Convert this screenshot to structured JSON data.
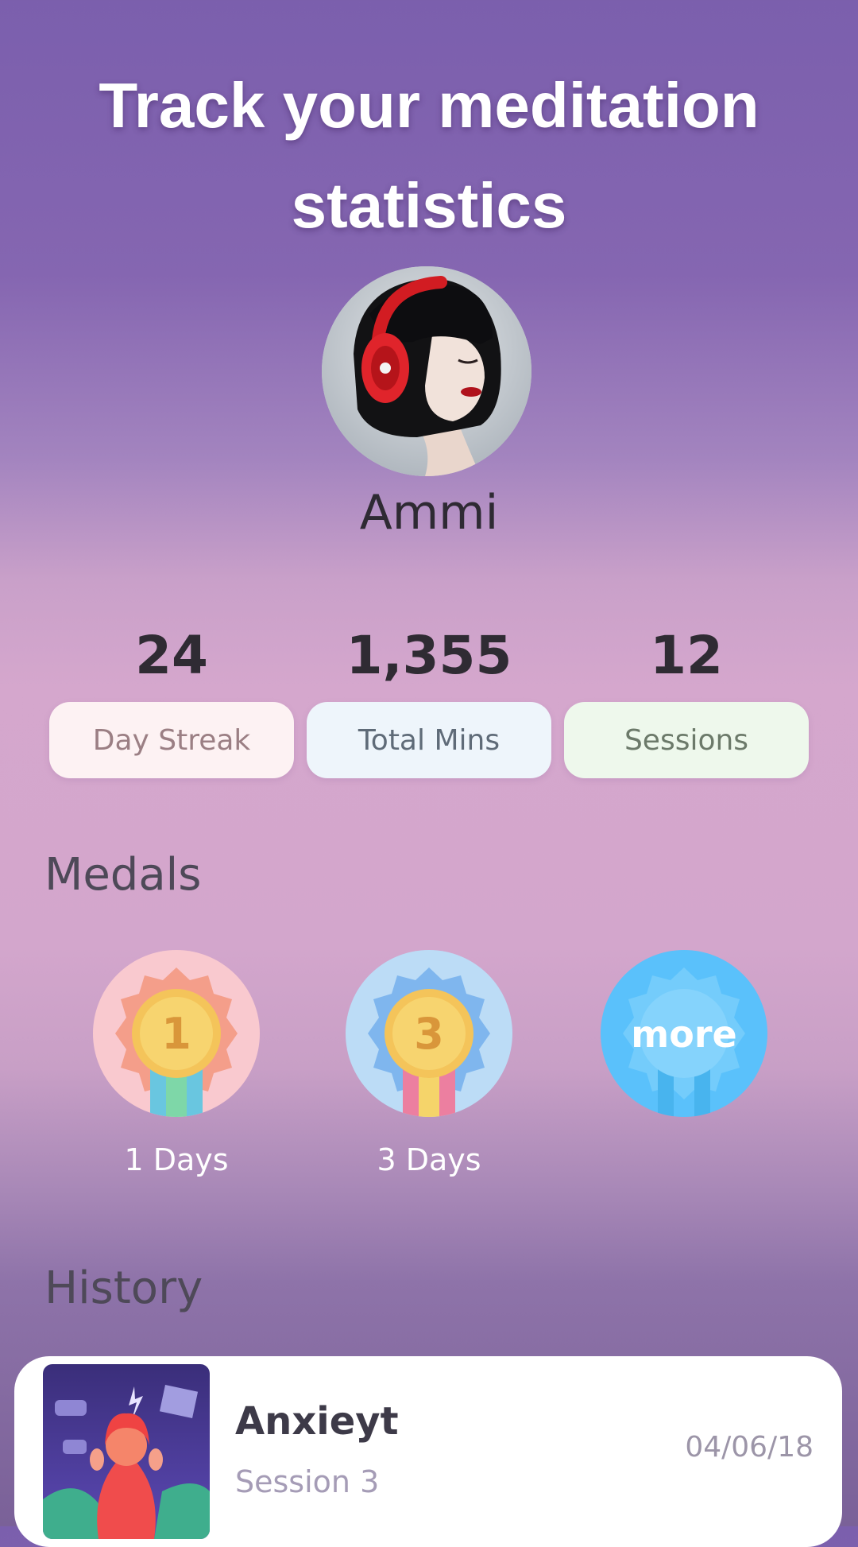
{
  "header": {
    "title_line1": "Track your meditation",
    "title_line2": "statistics"
  },
  "profile": {
    "name": "Ammi"
  },
  "stats": [
    {
      "value": "24",
      "label": "Day Streak",
      "bg": "#fdf2f3",
      "color": "#9b7f84"
    },
    {
      "value": "1,355",
      "label": "Total Mins",
      "bg": "#eef5fb",
      "color": "#5f6b78"
    },
    {
      "value": "12",
      "label": "Sessions",
      "bg": "#eef8ec",
      "color": "#6c7a6a"
    }
  ],
  "medals": {
    "title": "Medals",
    "items": [
      {
        "number": "1",
        "label": "1 Days",
        "bg": "#f9c9cf"
      },
      {
        "number": "3",
        "label": "3 Days",
        "bg": "#bcdcf6"
      },
      {
        "number": "more",
        "label": "",
        "bg": "#5ac1fb"
      }
    ]
  },
  "history": {
    "title": "History",
    "items": [
      {
        "title": "Anxieyt",
        "subtitle": "Session 3",
        "date": "04/06/18"
      }
    ]
  },
  "colors": {
    "accent_purple": "#7b5fad",
    "medal_gold": "#f4c45a"
  }
}
